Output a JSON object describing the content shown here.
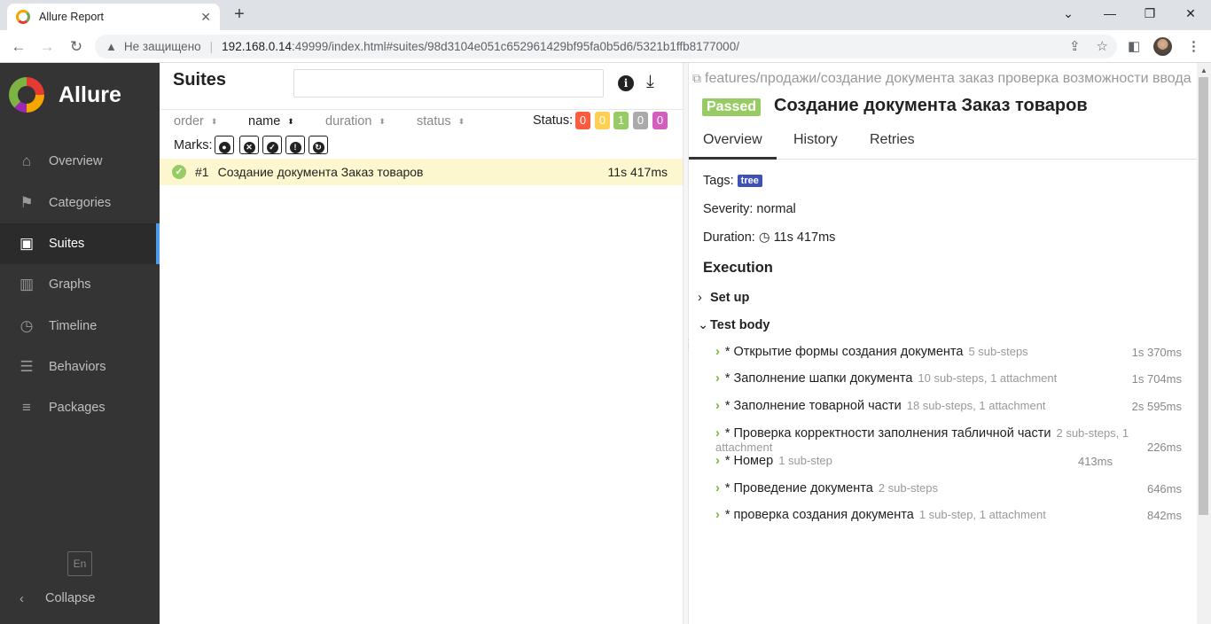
{
  "browser": {
    "tab_title": "Allure Report",
    "insecure_label": "Не защищено",
    "url_host": "192.168.0.14",
    "url_path": ":49999/index.html#suites/98d3104e051c652961429bf95fa0b5d6/5321b1ffb8177000/"
  },
  "sidebar": {
    "brand": "Allure",
    "items": [
      {
        "label": "Overview",
        "icon": "home-icon"
      },
      {
        "label": "Categories",
        "icon": "flag-icon"
      },
      {
        "label": "Suites",
        "icon": "briefcase-icon",
        "active": true
      },
      {
        "label": "Graphs",
        "icon": "bar-chart-icon"
      },
      {
        "label": "Timeline",
        "icon": "clock-icon"
      },
      {
        "label": "Behaviors",
        "icon": "list-icon"
      },
      {
        "label": "Packages",
        "icon": "align-left-icon"
      }
    ],
    "lang": "En",
    "collapse": "Collapse"
  },
  "suites": {
    "title": "Suites",
    "sort": {
      "order": "order",
      "name": "name",
      "duration": "duration",
      "status": "status"
    },
    "status_label": "Status:",
    "status_counts": [
      {
        "value": "0",
        "color": "#fd5a3e"
      },
      {
        "value": "0",
        "color": "#ffd050"
      },
      {
        "value": "1",
        "color": "#97cc64"
      },
      {
        "value": "0",
        "color": "#aaaaaa"
      },
      {
        "value": "0",
        "color": "#d35ebe"
      }
    ],
    "marks_label": "Marks:",
    "test": {
      "num": "#1",
      "name": "Создание документа Заказ товаров",
      "duration": "11s 417ms"
    }
  },
  "detail": {
    "path": "features/продажи/создание документа заказ проверка возможности ввода",
    "status": "Passed",
    "title": "Создание документа Заказ товаров",
    "tabs": [
      "Overview",
      "History",
      "Retries"
    ],
    "tags_label": "Tags:",
    "tag": "tree",
    "severity": "Severity: normal",
    "duration_label": "Duration:",
    "duration": "11s 417ms",
    "execution": "Execution",
    "setup": "Set up",
    "body": "Test body",
    "steps": [
      {
        "name": "* Открытие формы создания документа",
        "sub": "5 sub-steps",
        "time": "1s 370ms"
      },
      {
        "name": "* Заполнение шапки документа",
        "sub": "10 sub-steps, 1 attachment",
        "time": "1s 704ms"
      },
      {
        "name": "* Заполнение товарной части",
        "sub": "18 sub-steps, 1 attachment",
        "time": "2s 595ms"
      },
      {
        "name": "* Проверка корректности заполнения табличной части",
        "sub": "2 sub-steps, 1 attachment",
        "time": "226ms"
      },
      {
        "name": "* Номер",
        "sub": "1 sub-step",
        "time": "413ms"
      },
      {
        "name": "* Проведение документа",
        "sub": "2 sub-steps",
        "time": "646ms"
      },
      {
        "name": "* проверка создания документа",
        "sub": "1 sub-step, 1 attachment",
        "time": "842ms"
      }
    ]
  }
}
